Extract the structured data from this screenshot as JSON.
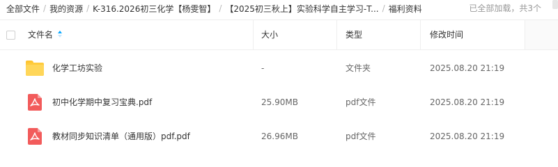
{
  "breadcrumb": {
    "items": [
      "全部文件",
      "我的资源",
      "K-316.2026初三化学【杨雯智】",
      "【2025初三秋上】实验科学自主学习-T...",
      "福利资料"
    ],
    "separator": "/"
  },
  "load_status": "已全部加载，共3个",
  "columns": {
    "name": "文件名",
    "size": "大小",
    "type": "类型",
    "modified": "修改时间"
  },
  "sort": {
    "column": "文件名",
    "direction": "ascending"
  },
  "files": [
    {
      "icon": "folder-icon",
      "name": "化学工坊实验",
      "size": "-",
      "type": "文件夹",
      "modified": "2025.08.20 21:19"
    },
    {
      "icon": "pdf-icon",
      "name": "初中化学期中复习宝典.pdf",
      "size": "25.90MB",
      "type": "pdf文件",
      "modified": "2025.08.20 21:19"
    },
    {
      "icon": "pdf-icon",
      "name": "教材同步知识清单（通用版）pdf.pdf",
      "size": "26.96MB",
      "type": "pdf文件",
      "modified": "2025.08.20 21:19"
    }
  ],
  "colors": {
    "accent": "#06a7ff",
    "folder": "#ffcb3d",
    "pdf": "#f25b5b",
    "divider": "#eeeeee",
    "muted_text": "#999999"
  }
}
